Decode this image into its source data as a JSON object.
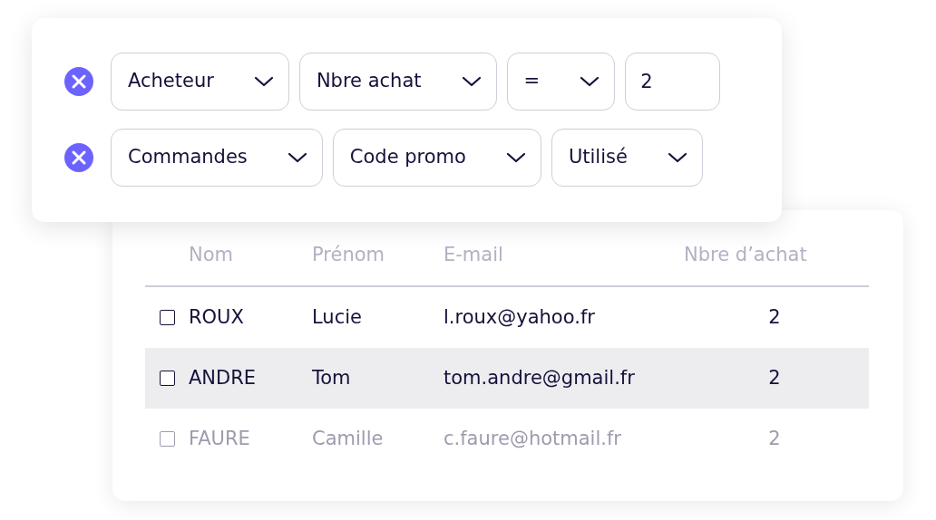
{
  "filters": [
    {
      "controls": [
        {
          "kind": "select",
          "value": "Acheteur"
        },
        {
          "kind": "select",
          "value": "Nbre achat"
        },
        {
          "kind": "select",
          "value": "="
        },
        {
          "kind": "input",
          "value": "2"
        }
      ]
    },
    {
      "controls": [
        {
          "kind": "select",
          "value": "Commandes"
        },
        {
          "kind": "select",
          "value": "Code promo"
        },
        {
          "kind": "select",
          "value": "Utilisé"
        }
      ]
    }
  ],
  "table": {
    "columns": [
      "Nom",
      "Prénom",
      "E-mail",
      "Nbre d’achat"
    ],
    "rows": [
      {
        "checked": false,
        "highlighted": false,
        "faded": false,
        "cells": [
          "ROUX",
          "Lucie",
          "l.roux@yahoo.fr",
          "2"
        ]
      },
      {
        "checked": false,
        "highlighted": true,
        "faded": false,
        "cells": [
          "ANDRE",
          "Tom",
          "tom.andre@gmail.fr",
          "2"
        ]
      },
      {
        "checked": false,
        "highlighted": false,
        "faded": true,
        "cells": [
          "FAURE",
          "Camille",
          "c.faure@hotmail.fr",
          "2"
        ]
      }
    ]
  }
}
